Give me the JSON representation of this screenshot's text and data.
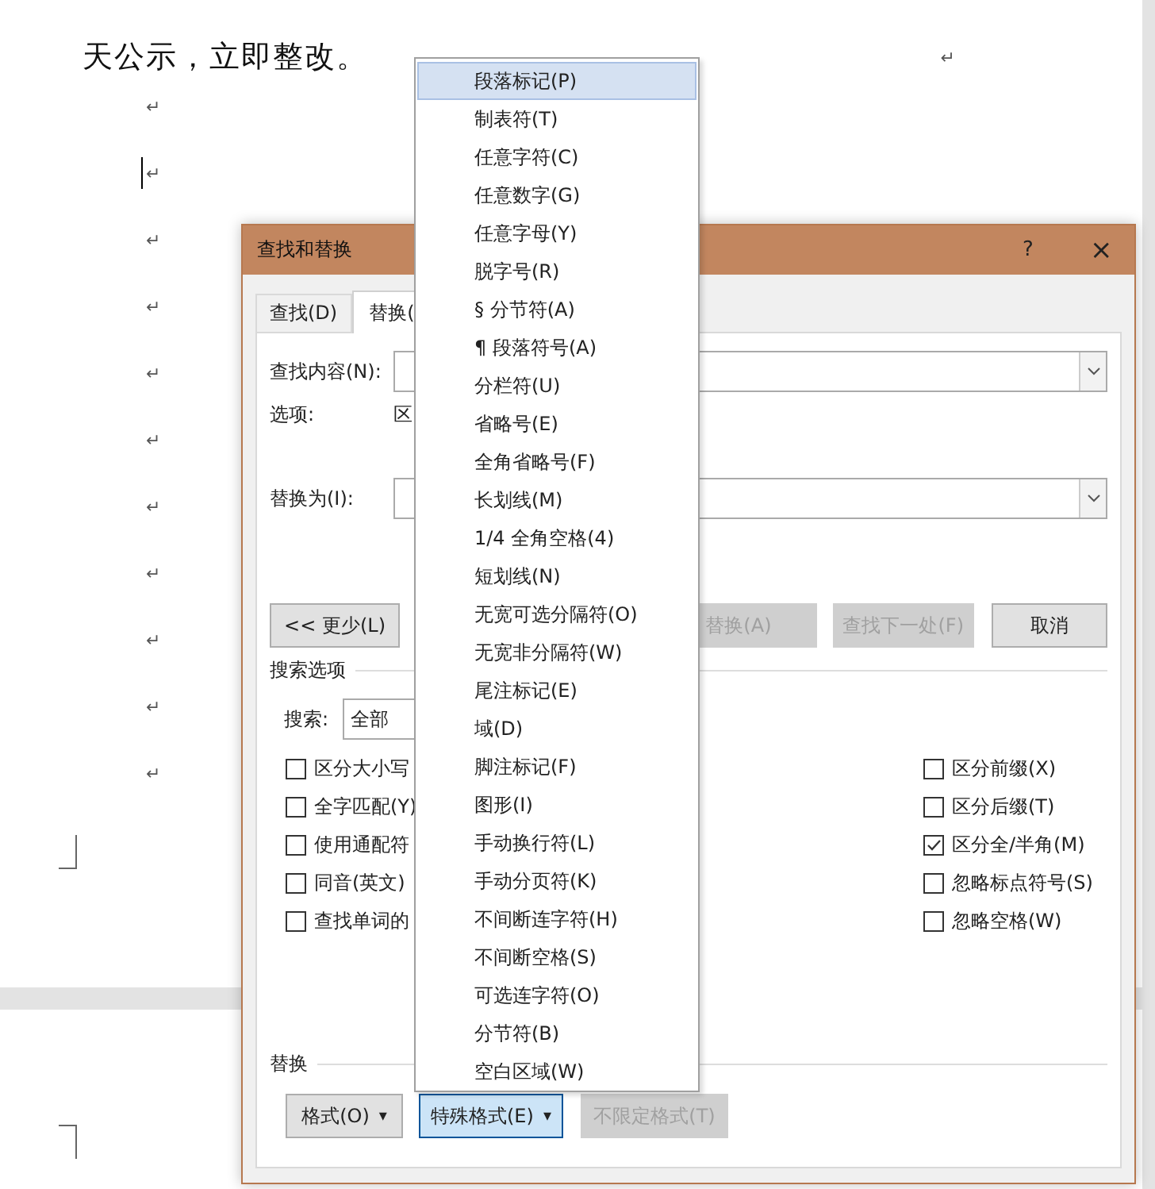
{
  "document": {
    "first_line": "天公示，立即整改。",
    "line_end_mark": "↵",
    "paragraph_marks": [
      "↵",
      "↵",
      "↵",
      "↵",
      "↵",
      "↵",
      "↵",
      "↵",
      "↵",
      "↵",
      "↵"
    ]
  },
  "dialog": {
    "title": "查找和替换",
    "help": "?",
    "close": "×",
    "tabs": [
      {
        "label": "查找(D)",
        "selected": false
      },
      {
        "label": "替换(",
        "selected": true
      }
    ],
    "find_label": "查找内容(N):",
    "options_label": "选项:",
    "options_value": "区",
    "replace_label": "替换为(I):",
    "buttons": [
      {
        "label": "<< 更少(L)",
        "disabled": false
      },
      {
        "label": "替换(A)",
        "disabled": true
      },
      {
        "label": "查找下一处(F)",
        "disabled": true
      },
      {
        "label": "取消",
        "disabled": false
      }
    ],
    "search_options_title": "搜索选项",
    "search_label": "搜索:",
    "search_value": "全部",
    "left_checks": [
      {
        "label": "区分大小写",
        "checked": false
      },
      {
        "label": "全字匹配(Y)",
        "checked": false
      },
      {
        "label": "使用通配符",
        "checked": false
      },
      {
        "label": "同音(英文)",
        "checked": false
      },
      {
        "label": "查找单词的",
        "checked": false
      }
    ],
    "right_checks": [
      {
        "label": "区分前缀(X)",
        "checked": false
      },
      {
        "label": "区分后缀(T)",
        "checked": false
      },
      {
        "label": "区分全/半角(M)",
        "checked": true
      },
      {
        "label": "忽略标点符号(S)",
        "checked": false
      },
      {
        "label": "忽略空格(W)",
        "checked": false
      }
    ],
    "replace_section_title": "替换",
    "bottom_buttons": [
      {
        "label": "格式(O)",
        "caret": "▾",
        "disabled": false,
        "active": false
      },
      {
        "label": "特殊格式(E)",
        "caret": "▾",
        "disabled": false,
        "active": true
      },
      {
        "label": "不限定格式(T)",
        "disabled": true,
        "active": false
      }
    ]
  },
  "menu": {
    "items": [
      {
        "label": "段落标记(P)",
        "selected": true
      },
      {
        "label": "制表符(T)",
        "selected": false
      },
      {
        "label": "任意字符(C)",
        "selected": false
      },
      {
        "label": "任意数字(G)",
        "selected": false
      },
      {
        "label": "任意字母(Y)",
        "selected": false
      },
      {
        "label": "脱字号(R)",
        "selected": false
      },
      {
        "label": "§ 分节符(A)",
        "selected": false
      },
      {
        "label": "¶ 段落符号(A)",
        "selected": false
      },
      {
        "label": "分栏符(U)",
        "selected": false
      },
      {
        "label": "省略号(E)",
        "selected": false
      },
      {
        "label": "全角省略号(F)",
        "selected": false
      },
      {
        "label": "长划线(M)",
        "selected": false
      },
      {
        "label": "1/4 全角空格(4)",
        "selected": false
      },
      {
        "label": "短划线(N)",
        "selected": false
      },
      {
        "label": "无宽可选分隔符(O)",
        "selected": false
      },
      {
        "label": "无宽非分隔符(W)",
        "selected": false
      },
      {
        "label": "尾注标记(E)",
        "selected": false
      },
      {
        "label": "域(D)",
        "selected": false
      },
      {
        "label": "脚注标记(F)",
        "selected": false
      },
      {
        "label": "图形(I)",
        "selected": false
      },
      {
        "label": "手动换行符(L)",
        "selected": false
      },
      {
        "label": "手动分页符(K)",
        "selected": false
      },
      {
        "label": "不间断连字符(H)",
        "selected": false
      },
      {
        "label": "不间断空格(S)",
        "selected": false
      },
      {
        "label": "可选连字符(O)",
        "selected": false
      },
      {
        "label": "分节符(B)",
        "selected": false
      },
      {
        "label": "空白区域(W)",
        "selected": false
      }
    ]
  }
}
